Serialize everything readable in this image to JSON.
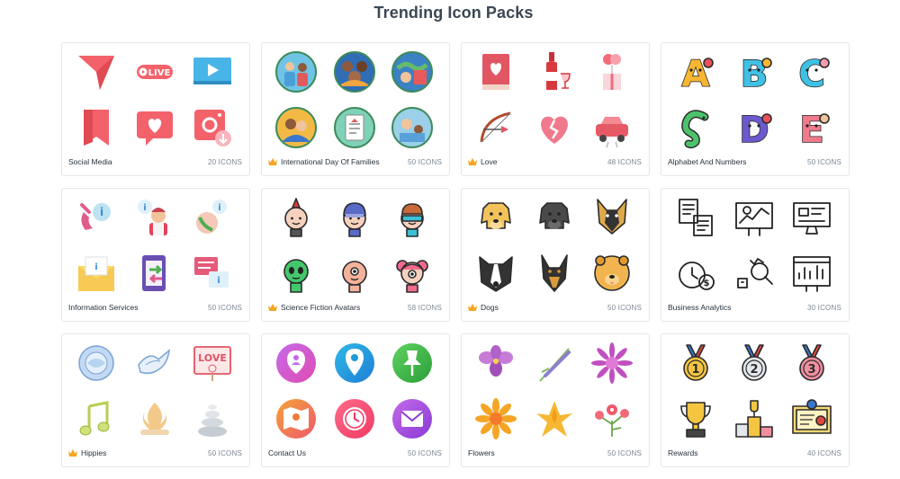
{
  "page": {
    "title": "Trending Icon Packs"
  },
  "colors": {
    "premium": "#f5a623",
    "border": "#e3e7ec",
    "title": "#3b4754"
  },
  "packs": [
    {
      "name": "Social Media",
      "count": "20 ICONS",
      "premium": false,
      "icons": [
        "send-icon",
        "live-icon",
        "play-screen-icon",
        "bookmark-icon",
        "heart-message-icon",
        "photo-download-icon"
      ]
    },
    {
      "name": "International Day Of Families",
      "count": "50 ICONS",
      "premium": true,
      "icons": [
        "family-couple-icon",
        "family-group-icon",
        "family-globe-icon",
        "family-hug-icon",
        "family-document-icon",
        "family-home-icon"
      ]
    },
    {
      "name": "Love",
      "count": "48 ICONS",
      "premium": true,
      "icons": [
        "love-book-icon",
        "wine-icon",
        "balloon-gift-icon",
        "cupid-bow-icon",
        "broken-heart-icon",
        "wedding-car-icon"
      ]
    },
    {
      "name": "Alphabet And Numbers",
      "count": "50 ICONS",
      "premium": false,
      "icons": [
        "letter-a-icon",
        "letter-b-icon",
        "letter-c-icon",
        "letter-c-snake-icon",
        "letter-d-icon",
        "letter-e-icon"
      ]
    },
    {
      "name": "Information Services",
      "count": "50 ICONS",
      "premium": false,
      "icons": [
        "info-phone-icon",
        "info-person-icon",
        "info-call-icon",
        "info-mail-icon",
        "info-phone-transfer-icon",
        "info-chat-icon"
      ]
    },
    {
      "name": "Science Fiction Avatars",
      "count": "58 ICONS",
      "premium": true,
      "icons": [
        "punk-avatar-icon",
        "astronaut-avatar-icon",
        "cyborg-avatar-icon",
        "alien-avatar-icon",
        "cyclops-avatar-icon",
        "girl-cyclops-avatar-icon"
      ]
    },
    {
      "name": "Dogs",
      "count": "50 ICONS",
      "premium": true,
      "icons": [
        "labrador-icon",
        "black-dog-icon",
        "german-shepherd-icon",
        "border-collie-icon",
        "doberman-icon",
        "chow-chow-icon"
      ]
    },
    {
      "name": "Business Analytics",
      "count": "30 ICONS",
      "premium": false,
      "icons": [
        "report-icon",
        "chart-board-icon",
        "dashboard-icon",
        "time-money-icon",
        "money-analysis-icon",
        "analytics-board-icon"
      ]
    },
    {
      "name": "Hippies",
      "count": "50 ICONS",
      "premium": true,
      "icons": [
        "flower-globe-icon",
        "dove-icon",
        "love-sign-icon",
        "music-note-icon",
        "campfire-icon",
        "stones-icon"
      ]
    },
    {
      "name": "Contact Us",
      "count": "50 ICONS",
      "premium": false,
      "icons": [
        "location-person-icon",
        "map-pin-icon",
        "pushpin-icon",
        "map-icon",
        "clock-icon",
        "mail-icon"
      ]
    },
    {
      "name": "Flowers",
      "count": "50 ICONS",
      "premium": false,
      "icons": [
        "orchid-icon",
        "lavender-icon",
        "aster-icon",
        "gerbera-icon",
        "lily-icon",
        "red-flowers-icon"
      ]
    },
    {
      "name": "Rewards",
      "count": "40 ICONS",
      "premium": false,
      "icons": [
        "gold-medal-icon",
        "silver-medal-icon",
        "bronze-medal-icon",
        "trophy-icon",
        "podium-icon",
        "certificate-icon"
      ]
    }
  ]
}
